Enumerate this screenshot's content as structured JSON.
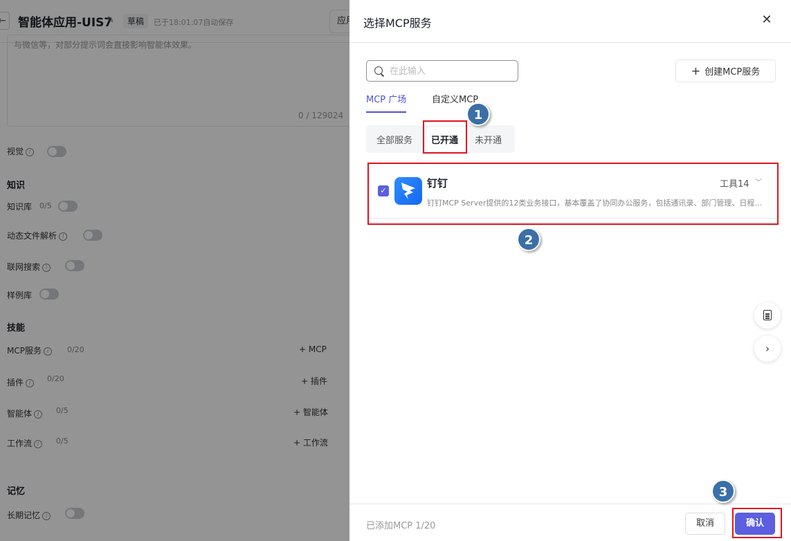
{
  "background": {
    "app_title": "智能体应用-UIS7",
    "draft_label": "草稿",
    "saved_status": "已于18:01:07自动保存",
    "header_button": "应用",
    "prompt_text": "与微信等，对部分提示词会直接影响智能体效果。",
    "prompt_count": "0 / 129024",
    "sections": {
      "vision": "视觉",
      "knowledge": "知识",
      "skills": "技能",
      "memory": "记忆"
    },
    "rows": {
      "knowledge_base": {
        "label": "知识库",
        "count": "0/5"
      },
      "dynamic_parse": {
        "label": "动态文件解析"
      },
      "web_search": {
        "label": "联网搜索"
      },
      "examples": {
        "label": "样例库"
      },
      "mcp": {
        "label": "MCP服务",
        "count": "0/20",
        "add": "+ MCP"
      },
      "plugins": {
        "label": "插件",
        "count": "0/20",
        "add": "+ 插件"
      },
      "agents": {
        "label": "智能体",
        "count": "0/5",
        "add": "+ 智能体"
      },
      "workflows": {
        "label": "工作流",
        "count": "0/5",
        "add": "+ 工作流"
      },
      "long_memory": {
        "label": "长期记忆"
      }
    }
  },
  "drawer": {
    "title": "选择MCP服务",
    "search_placeholder": "在此输入",
    "create_button": "创建MCP服务",
    "tabs": [
      {
        "label": "MCP 广场",
        "active": true
      },
      {
        "label": "自定义MCP",
        "active": false
      }
    ],
    "filters": [
      {
        "label": "全部服务",
        "active": false
      },
      {
        "label": "已开通",
        "active": true
      },
      {
        "label": "未开通",
        "active": false
      }
    ],
    "services": [
      {
        "name": "钉钉",
        "description": "钉钉MCP Server提供的12类业务接口，基本覆盖了协同办公服务，包括通讯录、部门管理、日程、待办、审批等",
        "tools": "工具14",
        "checked": true
      }
    ],
    "footer": {
      "added_text": "已添加MCP 1/20",
      "cancel": "取消",
      "confirm": "确认"
    }
  },
  "annotations": {
    "steps": [
      "1",
      "2",
      "3"
    ],
    "color": "#e0141e"
  },
  "icons": {
    "close": "close-icon",
    "search": "search-icon",
    "plus": "plus-icon",
    "chevron": "chevron-down-icon",
    "doc": "document-icon",
    "next": "chevron-right-icon",
    "edit": "pencil-icon",
    "back": "back-arrow-icon"
  },
  "colors": {
    "primary": "#5b5fe0",
    "tab_active": "#4e52d6",
    "badge": "#3b6fa8"
  }
}
